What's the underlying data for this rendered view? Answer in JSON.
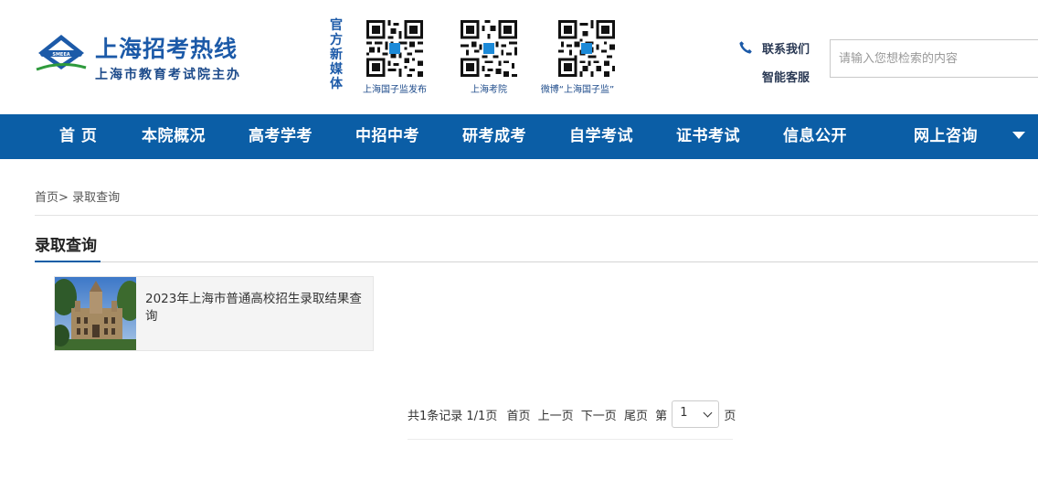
{
  "header": {
    "logo_title": "上海招考热线",
    "logo_subtitle": "上海市教育考试院主办",
    "logo_badge_text": "SMEEA",
    "media_label": [
      "官",
      "方",
      "新",
      "媒",
      "体"
    ],
    "qr_codes": [
      {
        "caption": "上海国子监发布",
        "icon": "qr-code-icon"
      },
      {
        "caption": "上海考院",
        "icon": "qr-code-icon"
      },
      {
        "caption": "微博“上海国子监”",
        "icon": "qr-code-icon"
      }
    ],
    "contact_label": "联系我们",
    "service_label": "智能客服",
    "phone_icon": "phone-icon",
    "search_placeholder": "请输入您想检索的内容"
  },
  "nav": {
    "items": [
      "首 页",
      "本院概况",
      "高考学考",
      "中招中考",
      "研考成考",
      "自学考试",
      "证书考试",
      "信息公开",
      "网上咨询"
    ],
    "more_icon": "caret-down-icon"
  },
  "breadcrumb": {
    "home": "首页",
    "separator": ">",
    "current": "录取查询"
  },
  "section": {
    "title": "录取查询"
  },
  "list": [
    {
      "title": "2023年上海市普通高校招生录取结果查询"
    }
  ],
  "pagination": {
    "summary": "共1条记录 1/1页",
    "first": "首页",
    "prev": "上一页",
    "next": "下一页",
    "last": "尾页",
    "page_prefix": "第",
    "page_value": "1",
    "page_suffix": "页"
  },
  "colors": {
    "nav_background": "#0b5ea6",
    "brand_blue": "#1c5aa8",
    "card_background": "#f4f4f4"
  }
}
